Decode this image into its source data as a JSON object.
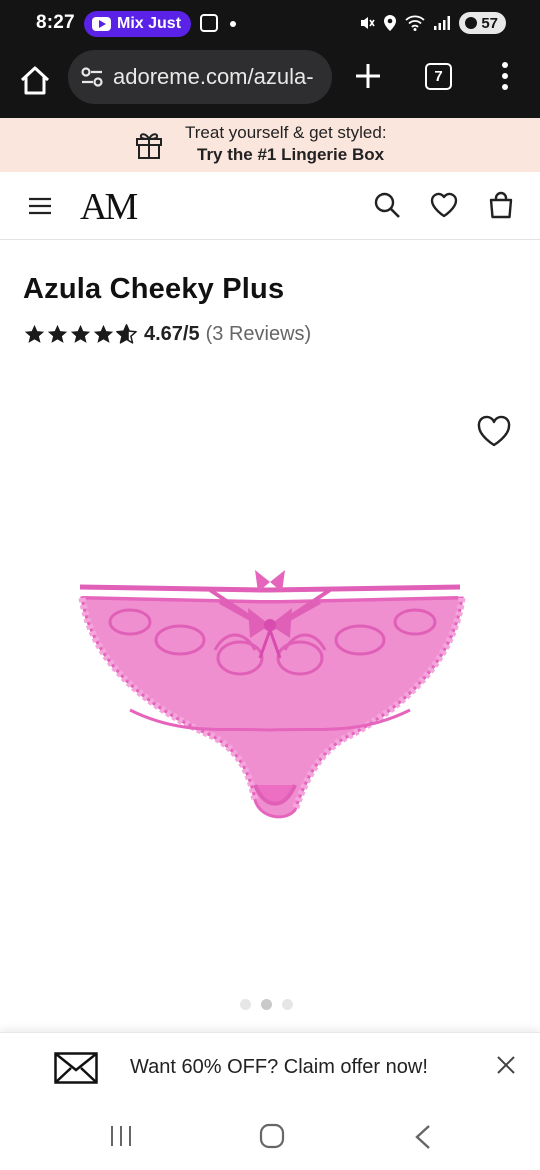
{
  "status_bar": {
    "time": "8:27",
    "media_pill": "Mix Just",
    "battery": "57"
  },
  "browser": {
    "url": "adoreme.com/azula-",
    "tab_count": "7"
  },
  "promo": {
    "line1": "Treat yourself & get styled:",
    "line2": "Try the #1 Lingerie Box",
    "background": "#fbe6de"
  },
  "header": {
    "logo": "AM"
  },
  "product": {
    "title": "Azula Cheeky Plus",
    "rating_score": "4.67/5",
    "rating_count": "(3 Reviews)",
    "rating_value": 4.67,
    "rating_max": 5,
    "color": "#ec6fc4",
    "image_count": 3,
    "active_image": 1
  },
  "offer": {
    "text": "Want 60% OFF? Claim offer now!"
  },
  "icons": {
    "browser": [
      "home-icon",
      "tune-icon",
      "plus-icon",
      "tabs-icon",
      "more-vertical-icon"
    ],
    "header": [
      "menu-icon",
      "search-icon",
      "heart-icon",
      "shopping-bag-icon"
    ],
    "product": [
      "star-icon",
      "heart-icon"
    ],
    "offer": [
      "envelope-icon",
      "close-icon"
    ],
    "nav": [
      "recents-icon",
      "home-circle-icon",
      "back-icon"
    ]
  }
}
